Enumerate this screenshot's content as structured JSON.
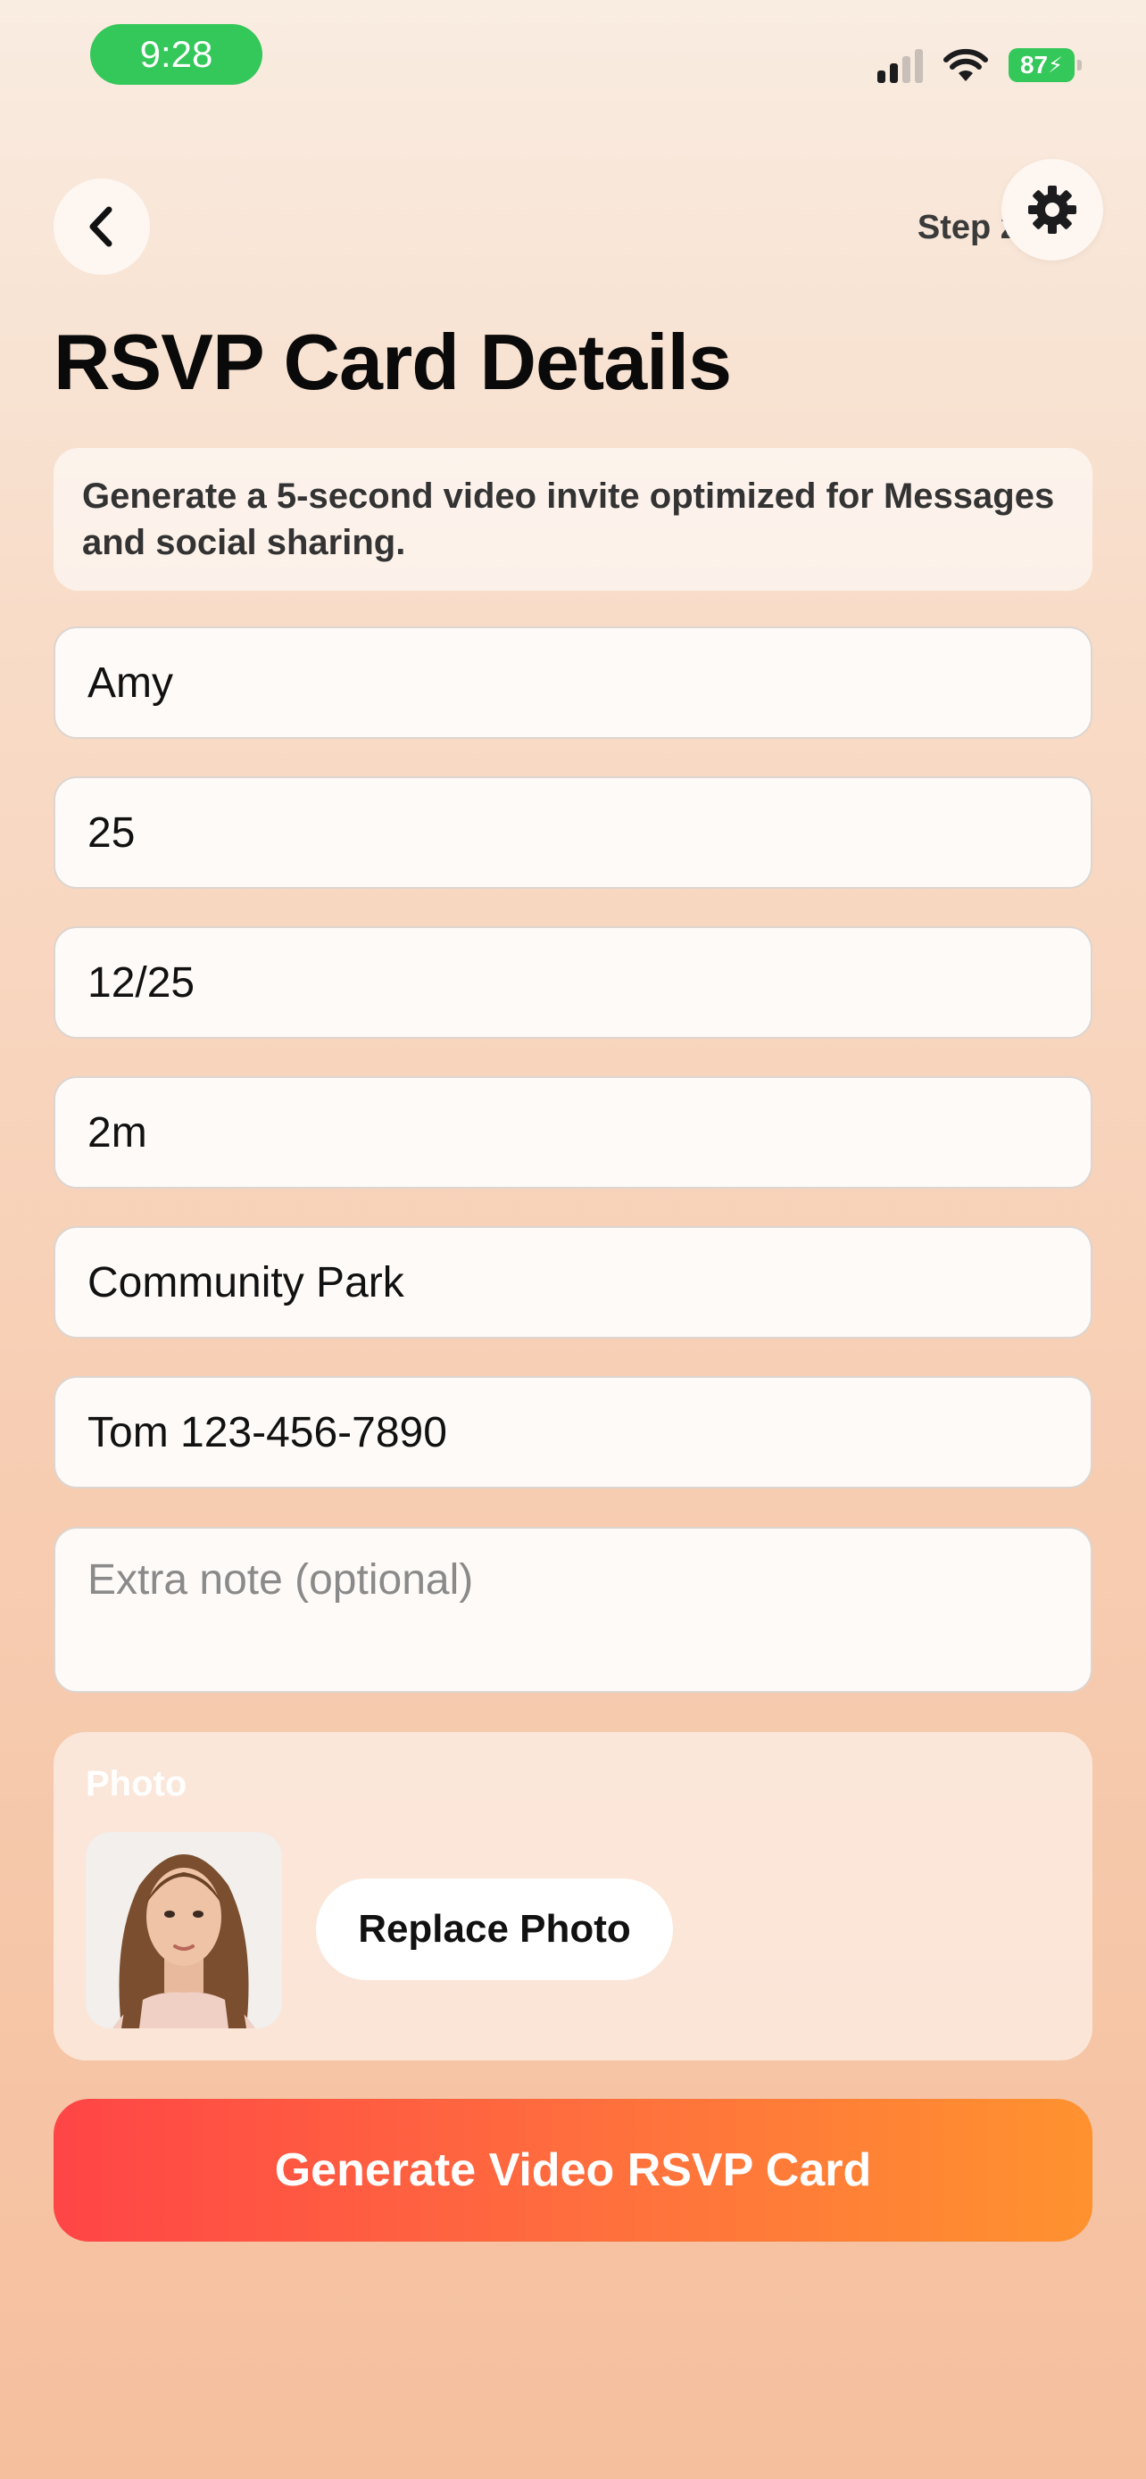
{
  "status_bar": {
    "time": "9:28",
    "battery": "87"
  },
  "header": {
    "step_text": "Step 2 of 3",
    "title": "RSVP Card Details"
  },
  "info": {
    "text": "Generate a 5-second video invite optimized for Messages and social sharing."
  },
  "form": {
    "name": "Amy",
    "age": "25",
    "date": "12/25",
    "time": "2m",
    "location": "Community Park",
    "contact": "Tom 123-456-7890",
    "note_placeholder": "Extra note (optional)"
  },
  "photo": {
    "label": "Photo",
    "replace_label": "Replace Photo"
  },
  "actions": {
    "generate_label": "Generate Video RSVP Card"
  },
  "colors": {
    "accent_start": "#ff4546",
    "accent_end": "#ff922f",
    "status_green": "#34c759"
  },
  "icons": {
    "back": "chevron-left-icon",
    "settings": "gear-icon",
    "wifi": "wifi-icon",
    "signal": "cellular-signal-icon"
  }
}
